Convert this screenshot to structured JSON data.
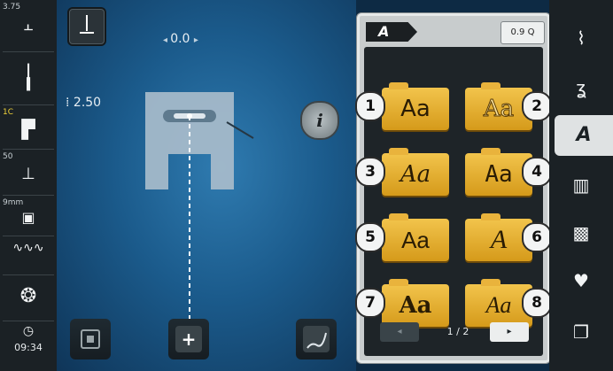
{
  "left_status": {
    "stitch_width_label": "3.75",
    "needle_label": "1C",
    "presser_label": "50",
    "stitch_plate_label": "9mm",
    "time": "09:34"
  },
  "workspace": {
    "stitch_position_value": "0.0",
    "stitch_length_value": "2.50",
    "info_label": "i",
    "plus_label": "+"
  },
  "panel": {
    "tab_label": "A",
    "zoom_label": "0.9 Q",
    "fonts": [
      {
        "number": "1",
        "sample": "Aa"
      },
      {
        "number": "2",
        "sample": "Aa"
      },
      {
        "number": "3",
        "sample": "Aa"
      },
      {
        "number": "4",
        "sample": "Aa"
      },
      {
        "number": "5",
        "sample": "Aa"
      },
      {
        "number": "6",
        "sample": "A"
      },
      {
        "number": "7",
        "sample": "Aa"
      },
      {
        "number": "8",
        "sample": "Aa"
      }
    ],
    "page_indicator": "1 / 2"
  },
  "right_menu": {
    "alphabet_label": "A"
  },
  "icons": {
    "back": "arrow-left-icon",
    "forward": "arrow-right-icon"
  }
}
